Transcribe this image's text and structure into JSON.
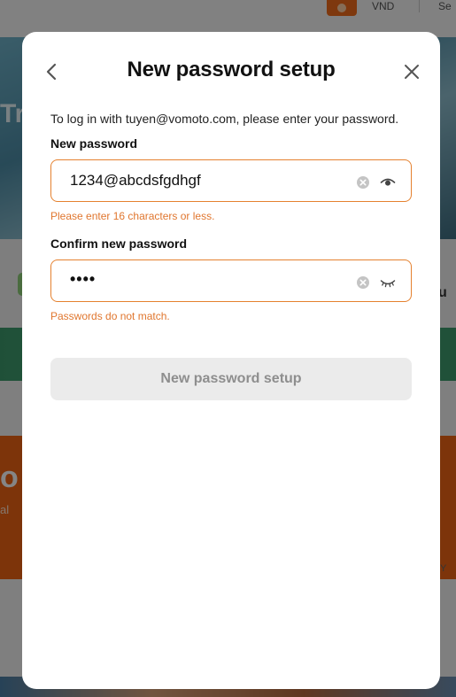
{
  "background": {
    "currency": "VND",
    "more": "Se",
    "hero_text": "Tr",
    "side_text": "u",
    "promo_title": "o t",
    "promo_sub": "al ",
    "side_hint": "Y"
  },
  "modal": {
    "title": "New password setup",
    "back_icon": "chevron-left-icon",
    "close_icon": "close-icon",
    "intro": "To log in with tuyen@vomoto.com, please enter your password.",
    "new_password": {
      "label": "New password",
      "value": "1234@abcdsfgdhgf",
      "error": "Please enter 16 characters or less.",
      "visibility": "shown",
      "toggle_icon": "eye-open-icon"
    },
    "confirm_password": {
      "label": "Confirm new password",
      "value": "••••",
      "error": "Passwords do not match.",
      "visibility": "hidden",
      "toggle_icon": "eye-closed-icon"
    },
    "submit_label": "New password setup",
    "submit_disabled": true
  },
  "colors": {
    "accent": "#e5812f",
    "error_text": "#e0762e",
    "disabled_bg": "#ebebeb",
    "disabled_text": "#8e8e8e"
  }
}
